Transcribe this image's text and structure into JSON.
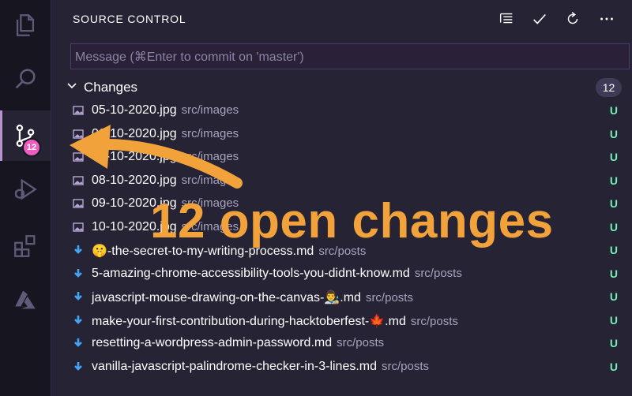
{
  "activity_bar": {
    "items": [
      {
        "icon": "files-icon",
        "active": false
      },
      {
        "icon": "search-icon",
        "active": false
      },
      {
        "icon": "source-control-icon",
        "active": true,
        "badge": "12"
      },
      {
        "icon": "run-debug-icon",
        "active": false
      },
      {
        "icon": "extensions-icon",
        "active": false
      },
      {
        "icon": "azure-icon",
        "active": false
      }
    ]
  },
  "sidebar": {
    "title": "SOURCE CONTROL",
    "toolbar_icons": [
      "view-as-tree-icon",
      "commit-check-icon",
      "refresh-icon",
      "more-actions-icon"
    ],
    "commit_message_placeholder": "Message (⌘Enter to commit on 'master')",
    "changes": {
      "label": "Changes",
      "count": "12",
      "files": [
        {
          "name": "05-10-2020.jpg",
          "path": "src/images",
          "status": "U",
          "icon": "image-file-icon"
        },
        {
          "name": "06-10-2020.jpg",
          "path": "src/images",
          "status": "U",
          "icon": "image-file-icon"
        },
        {
          "name": "07-10-2020.jpg",
          "path": "src/images",
          "status": "U",
          "icon": "image-file-icon"
        },
        {
          "name": "08-10-2020.jpg",
          "path": "src/images",
          "status": "U",
          "icon": "image-file-icon"
        },
        {
          "name": "09-10-2020.jpg",
          "path": "src/images",
          "status": "U",
          "icon": "image-file-icon"
        },
        {
          "name": "10-10-2020.jpg",
          "path": "src/images",
          "status": "U",
          "icon": "image-file-icon"
        },
        {
          "name": "🤫-the-secret-to-my-writing-process.md",
          "path": "src/posts",
          "status": "U",
          "icon": "markdown-file-icon"
        },
        {
          "name": "5-amazing-chrome-accessibility-tools-you-didnt-know.md",
          "path": "src/posts",
          "status": "U",
          "icon": "markdown-file-icon"
        },
        {
          "name": "javascript-mouse-drawing-on-the-canvas-👨‍🎨.md",
          "path": "src/posts",
          "status": "U",
          "icon": "markdown-file-icon"
        },
        {
          "name": "make-your-first-contribution-during-hacktoberfest-🍁.md",
          "path": "src/posts",
          "status": "U",
          "icon": "markdown-file-icon"
        },
        {
          "name": "resetting-a-wordpress-admin-password.md",
          "path": "src/posts",
          "status": "U",
          "icon": "markdown-file-icon"
        },
        {
          "name": "vanilla-javascript-palindrome-checker-in-3-lines.md",
          "path": "src/posts",
          "status": "U",
          "icon": "markdown-file-icon"
        }
      ]
    }
  },
  "annotation": {
    "text": "12 open changes",
    "color": "#f2a23a"
  },
  "colors": {
    "untracked_status": "#72f1b8",
    "badge": "#ec5dbf",
    "background": "#262335"
  }
}
